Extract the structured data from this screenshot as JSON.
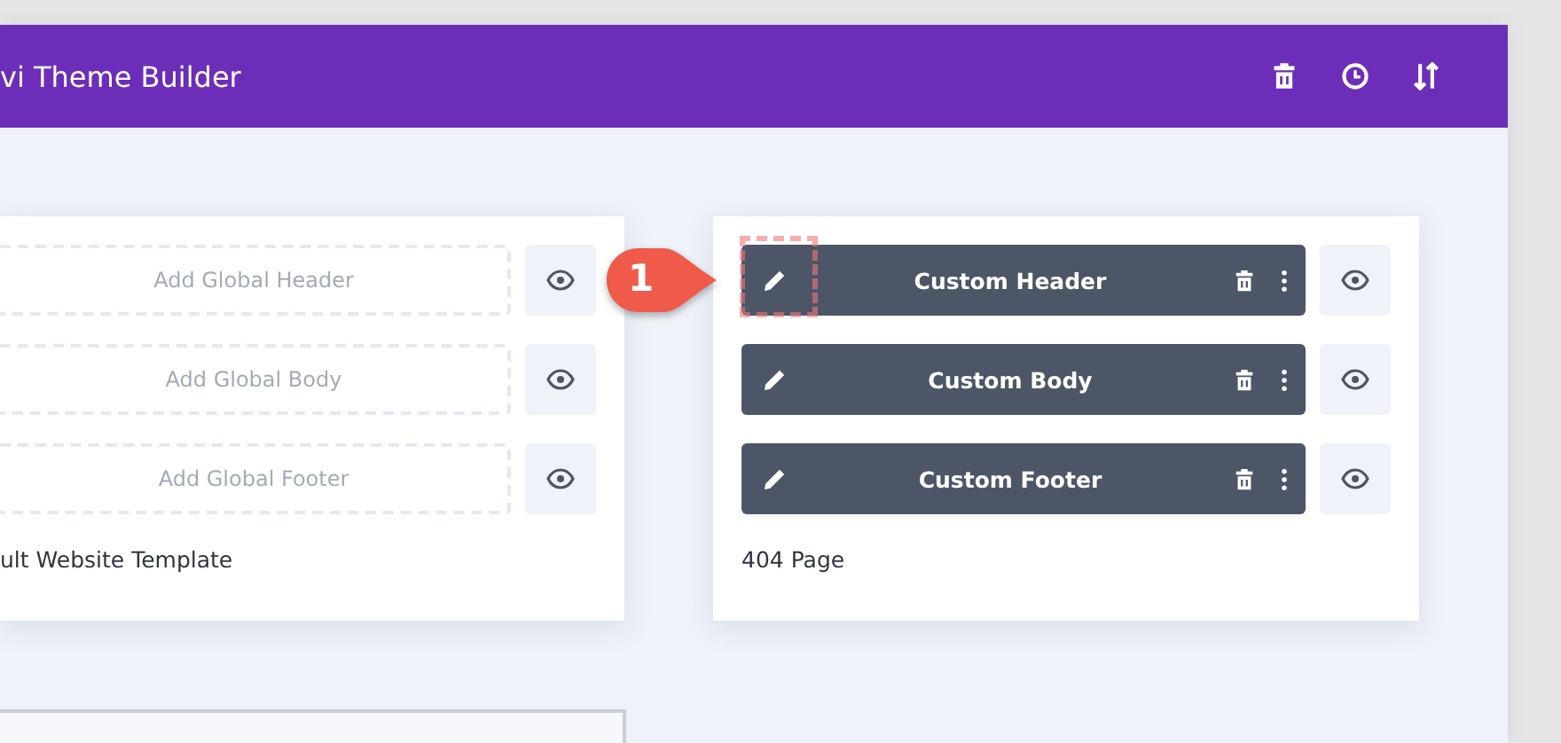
{
  "header": {
    "title": "vi Theme Builder"
  },
  "templates": [
    {
      "name": "ult Website Template",
      "slots": [
        {
          "label": "Add Global Header",
          "kind": "empty",
          "highlighted": false
        },
        {
          "label": "Add Global Body",
          "kind": "empty",
          "highlighted": false
        },
        {
          "label": "Add Global Footer",
          "kind": "empty",
          "highlighted": false
        }
      ]
    },
    {
      "name": "404 Page",
      "slots": [
        {
          "label": "Custom Header",
          "kind": "custom",
          "highlighted": true
        },
        {
          "label": "Custom Body",
          "kind": "custom",
          "highlighted": false
        },
        {
          "label": "Custom Footer",
          "kind": "custom",
          "highlighted": false
        }
      ]
    }
  ],
  "callout": {
    "number": "1"
  }
}
